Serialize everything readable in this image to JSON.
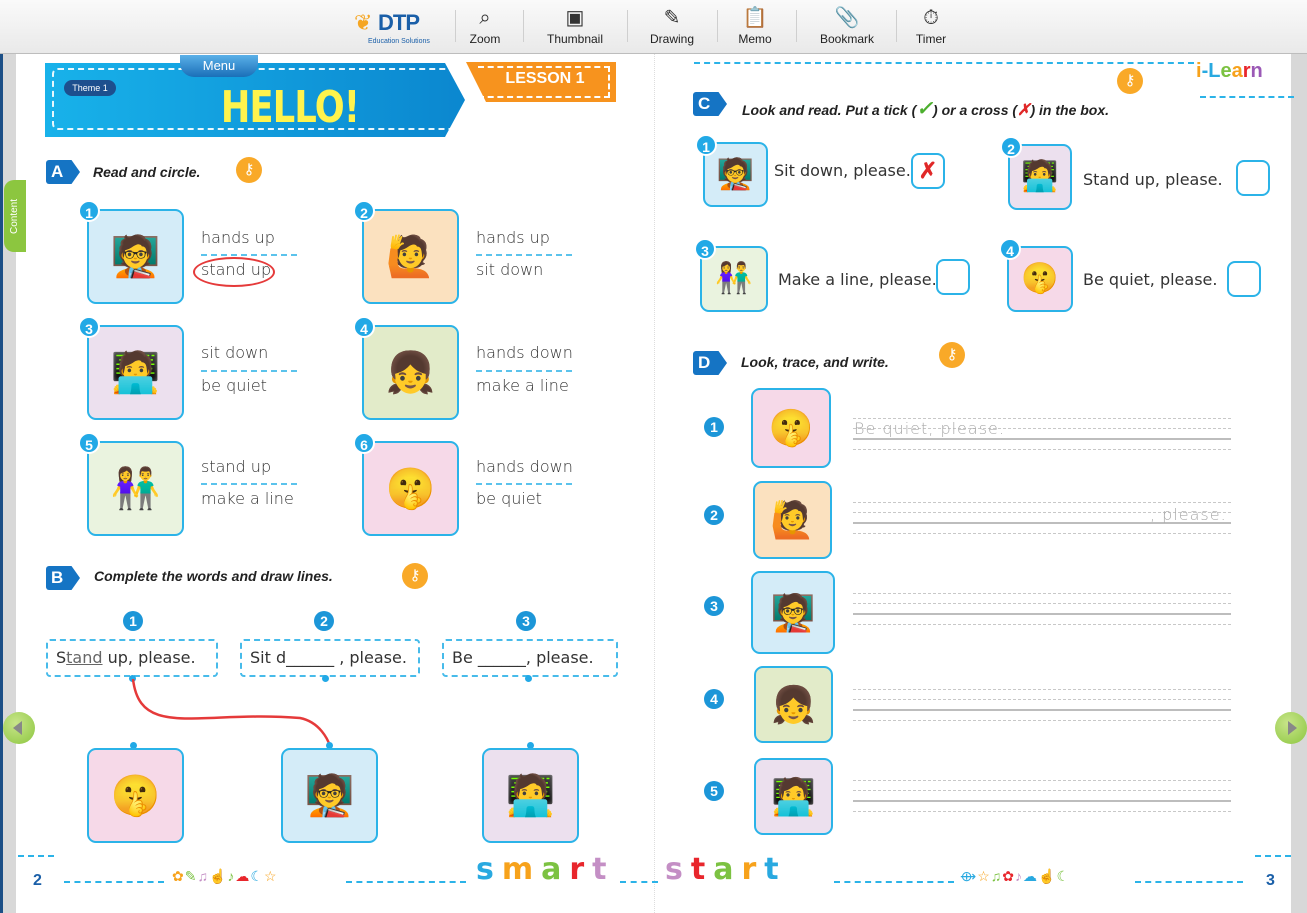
{
  "toolbar": {
    "logo_text": "DTP",
    "logo_sub": "Education Solutions",
    "buttons": [
      {
        "label": "Zoom",
        "icon": "magnifier-icon"
      },
      {
        "label": "Thumbnail",
        "icon": "image-icon"
      },
      {
        "label": "Drawing",
        "icon": "pencil-icon"
      },
      {
        "label": "Memo",
        "icon": "clipboard-icon"
      },
      {
        "label": "Bookmark",
        "icon": "paperclip-icon"
      },
      {
        "label": "Timer",
        "icon": "stopwatch-icon"
      }
    ]
  },
  "side": {
    "content_tab": "Content"
  },
  "header": {
    "menu": "Menu",
    "theme": "Theme 1",
    "title": "HELLO!",
    "lesson": "LESSON 1",
    "brand": "i-Learn"
  },
  "sectionA": {
    "letter": "A",
    "title": "Read and circle.",
    "items": [
      {
        "num": "1",
        "opt1": "hands up",
        "opt2": "stand up",
        "circled": 2
      },
      {
        "num": "2",
        "opt1": "hands up",
        "opt2": "sit down"
      },
      {
        "num": "3",
        "opt1": "sit down",
        "opt2": "be quiet"
      },
      {
        "num": "4",
        "opt1": "hands down",
        "opt2": "make a line"
      },
      {
        "num": "5",
        "opt1": "stand up",
        "opt2": "make a line"
      },
      {
        "num": "6",
        "opt1": "hands down",
        "opt2": "be quiet"
      }
    ]
  },
  "sectionB": {
    "letter": "B",
    "title": "Complete the words and draw lines.",
    "items": [
      {
        "num": "1",
        "pre": "S",
        "filled": "tand",
        "post": " up, please."
      },
      {
        "num": "2",
        "pre": "Sit d",
        "filled": "______",
        "post": " , please."
      },
      {
        "num": "3",
        "pre": "Be ",
        "filled": "______",
        "post": ", please."
      }
    ]
  },
  "sectionC": {
    "letter": "C",
    "title_part1": "Look and read. Put a tick (",
    "tick": "✓",
    "title_part2": ") or a cross (",
    "cross": "✗",
    "title_part3": ") in the box.",
    "items": [
      {
        "num": "1",
        "text": "Sit down, please.",
        "mark": "✗"
      },
      {
        "num": "2",
        "text": "Stand up, please.",
        "mark": ""
      },
      {
        "num": "3",
        "text": "Make a line, please.",
        "mark": ""
      },
      {
        "num": "4",
        "text": "Be quiet, please.",
        "mark": ""
      }
    ]
  },
  "sectionD": {
    "letter": "D",
    "title": "Look, trace, and write.",
    "items": [
      {
        "num": "1",
        "trace": "Be quiet, please."
      },
      {
        "num": "2",
        "trace": ", please."
      },
      {
        "num": "3",
        "trace": ""
      },
      {
        "num": "4",
        "trace": ""
      },
      {
        "num": "5",
        "trace": ""
      }
    ]
  },
  "footer": {
    "left_page": "2",
    "right_page": "3",
    "word1": [
      "s",
      "m",
      "a",
      "r",
      "t"
    ],
    "word2": [
      "s",
      "t",
      "a",
      "r",
      "t"
    ],
    "word1_colors": [
      "#29a9e0",
      "#f7a21b",
      "#7cc242",
      "#e8262c",
      "#c48fc5"
    ],
    "word2_colors": [
      "#c48fc5",
      "#e8262c",
      "#7cc242",
      "#f7a21b",
      "#29a9e0"
    ]
  }
}
